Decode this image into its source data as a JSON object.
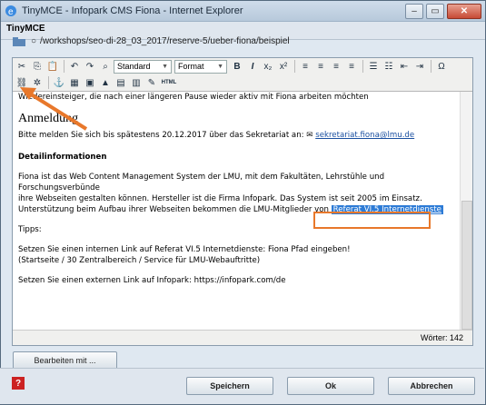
{
  "window": {
    "title": "TinyMCE - Infopark CMS Fiona - Internet Explorer",
    "dialog_title": "TinyMCE"
  },
  "path": {
    "text": "/workshops/seo-di-28_03_2017/reserve-5/ueber-fiona/beispiel"
  },
  "toolbar": {
    "style_select": "Standard",
    "format_select": "Format",
    "html_label": "HTML"
  },
  "content": {
    "line1": "Wiedereinsteiger, die nach einer längeren Pause wieder aktiv mit Fiona arbeiten möchten",
    "heading": "Anmeldung",
    "signup_text": "Bitte melden Sie sich bis spätestens 20.12.2017 über das Sekretariat an: ",
    "signup_email": "sekretariat.fiona@lmu.de",
    "detail_heading": "Detailinformationen",
    "para1_line1": "Fiona ist das Web Content Management System der LMU, mit dem Fakultäten, Lehrstühle und Forschungsverbünde",
    "para1_line2": "ihre Webseiten gestalten können. Hersteller ist die Firma Infopark. Das System ist seit 2005 im Einsatz.",
    "para1_line3": "Unterstützung beim Aufbau ihrer Webseiten bekommen die LMU-Mitglieder von ",
    "para1_link": "Referat VI.5 Internetdienste",
    "tips": "Tipps:",
    "tip1_line1": "Setzen Sie einen internen Link auf Referat VI.5 Internetdienste: Fiona Pfad eingeben!",
    "tip1_line2": "(Startseite / 30 Zentralbereich / Service für LMU-Webauftritte)",
    "tip2": "Setzen Sie einen externen Link auf Infopark: https://infopark.com/de"
  },
  "status": {
    "words": "Wörter: 142"
  },
  "buttons": {
    "edit_with": "Bearbeiten mit ...",
    "save": "Speichern",
    "ok": "Ok",
    "cancel": "Abbrechen"
  },
  "colors": {
    "annotation": "#e8782b",
    "link": "#1a4fa0",
    "selection": "#2d7bd6"
  }
}
